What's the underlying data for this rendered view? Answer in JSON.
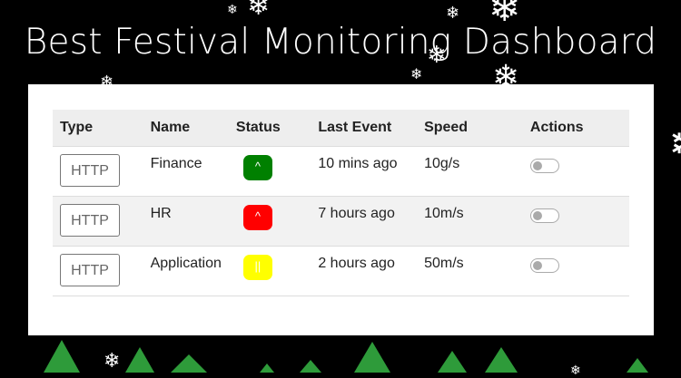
{
  "header": {
    "title": "Best Festival Monitoring Dashboard"
  },
  "table": {
    "columns": [
      "Type",
      "Name",
      "Status",
      "Last Event",
      "Speed",
      "Actions"
    ],
    "rows": [
      {
        "type": "HTTP",
        "name": "Finance",
        "status_symbol": "^",
        "status_color": "#008000",
        "last_event": "10 mins ago",
        "speed": "10g/s",
        "action_on": false
      },
      {
        "type": "HTTP",
        "name": "HR",
        "status_symbol": "^",
        "status_color": "#ff0000",
        "last_event": "7 hours ago",
        "speed": "10m/s",
        "action_on": false
      },
      {
        "type": "HTTP",
        "name": "Application",
        "status_symbol": "||",
        "status_color": "#ffff00",
        "last_event": "2 hours ago",
        "speed": "50m/s",
        "action_on": false
      }
    ]
  },
  "decor": {
    "background": "#000000",
    "tree_color": "#2e9b3a",
    "snowflake_icon": "snowflake-icon"
  }
}
